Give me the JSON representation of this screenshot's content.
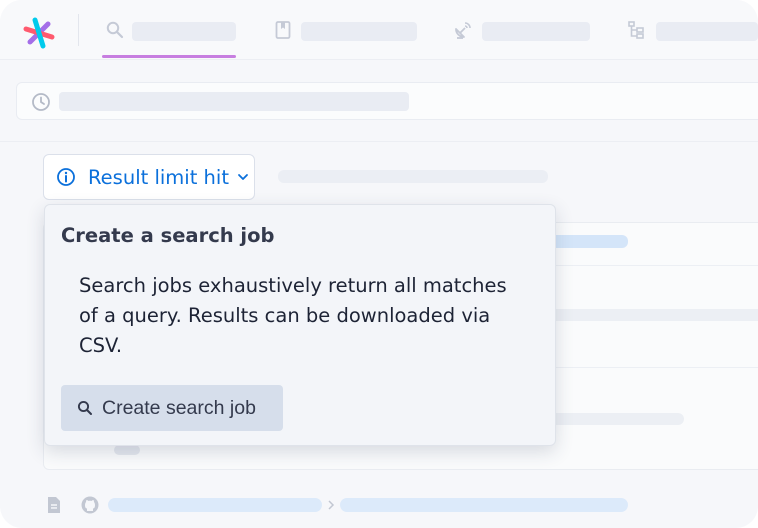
{
  "nav": {
    "items": [
      {
        "icon": "search-icon",
        "active": true
      },
      {
        "icon": "notebook-icon",
        "active": false
      },
      {
        "icon": "satellite-dish-icon",
        "active": false
      },
      {
        "icon": "file-tree-icon",
        "active": false
      }
    ],
    "accent_color": "#c77ee0"
  },
  "search": {
    "icon": "history-clock-icon"
  },
  "result_limit": {
    "label": "Result limit hit",
    "icon": "info-icon",
    "color": "#0b70db"
  },
  "popover": {
    "title": "Create a search job",
    "description": "Search jobs exhaustively return all matches of a query. Results can be downloaded via CSV.",
    "button_label": "Create search job",
    "button_icon": "search-icon"
  },
  "result_footer": {
    "icons": [
      "file-icon",
      "github-icon",
      "chevron-right-icon"
    ]
  }
}
